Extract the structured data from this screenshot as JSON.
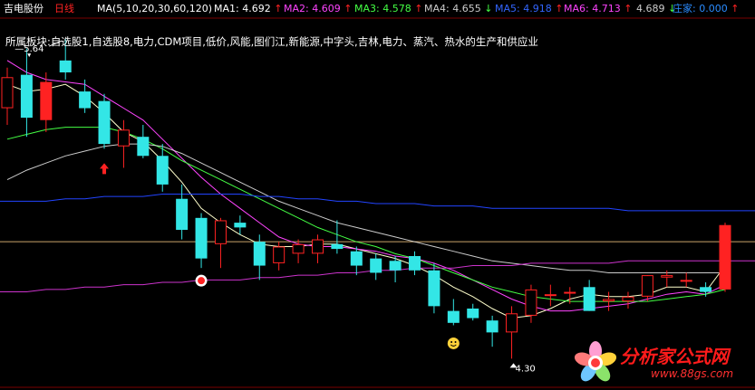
{
  "header": {
    "stock_name": "吉电股份",
    "period": "日线",
    "ma_spec": "MA(5,10,20,30,60,120)",
    "indicators": [
      {
        "label": "MA1:",
        "value": "4.692",
        "trend": "↑",
        "color": "#ffffff"
      },
      {
        "label": "MA2:",
        "value": "4.609",
        "trend": "↑",
        "color": "#ff44ff"
      },
      {
        "label": "MA3:",
        "value": "4.578",
        "trend": "↑",
        "color": "#44ff44"
      },
      {
        "label": "MA4:",
        "value": "4.655",
        "trend": "↓",
        "color": "#cccccc"
      },
      {
        "label": "MA5:",
        "value": "4.918",
        "trend": "↑",
        "color": "#3366ff"
      },
      {
        "label": "MA6:",
        "value": "4.713",
        "trend": "↑",
        "color": "#ff44ff"
      },
      {
        "label": "",
        "value": "4.689",
        "trend": "↓",
        "color": "#cccccc"
      },
      {
        "label": "庄家:",
        "value": "0.000",
        "trend": "↑",
        "color": "#2a8cff"
      }
    ]
  },
  "blocks_text": "所属板块:自选股1,自选股8,电力,CDM项目,低价,风能,图们江,新能源,中字头,吉林,电力、蒸汽、热水的生产和供应业",
  "watermark": {
    "text": "分析家公式网",
    "url": "www.88gs.com"
  },
  "chart_data": {
    "type": "candlestick",
    "price_range": [
      4.18,
      5.72
    ],
    "high_annotation": "5.64",
    "low_annotation": "4.30",
    "colors": {
      "up": "#ff2222",
      "down": "#33e6e6",
      "ma5": "#ffffcc",
      "ma10": "#ff44ff",
      "ma20": "#44ff44",
      "ma60": "#2244ff",
      "ma120": "#cc33cc",
      "level": "#c9a36a"
    },
    "candles": [
      {
        "o": 5.35,
        "h": 5.52,
        "l": 5.28,
        "c": 5.48
      },
      {
        "o": 5.49,
        "h": 5.6,
        "l": 5.23,
        "c": 5.31
      },
      {
        "o": 5.3,
        "h": 5.5,
        "l": 5.25,
        "c": 5.46
      },
      {
        "o": 5.55,
        "h": 5.64,
        "l": 5.47,
        "c": 5.5
      },
      {
        "o": 5.42,
        "h": 5.47,
        "l": 5.33,
        "c": 5.35
      },
      {
        "o": 5.38,
        "h": 5.41,
        "l": 5.18,
        "c": 5.2
      },
      {
        "o": 5.19,
        "h": 5.3,
        "l": 5.1,
        "c": 5.26
      },
      {
        "o": 5.23,
        "h": 5.28,
        "l": 5.14,
        "c": 5.15
      },
      {
        "o": 5.15,
        "h": 5.2,
        "l": 5.0,
        "c": 5.03
      },
      {
        "o": 4.97,
        "h": 5.03,
        "l": 4.8,
        "c": 4.84
      },
      {
        "o": 4.89,
        "h": 4.91,
        "l": 4.68,
        "c": 4.72
      },
      {
        "o": 4.78,
        "h": 4.89,
        "l": 4.68,
        "c": 4.88
      },
      {
        "o": 4.87,
        "h": 4.9,
        "l": 4.82,
        "c": 4.85
      },
      {
        "o": 4.79,
        "h": 4.82,
        "l": 4.63,
        "c": 4.69
      },
      {
        "o": 4.7,
        "h": 4.79,
        "l": 4.67,
        "c": 4.77
      },
      {
        "o": 4.74,
        "h": 4.8,
        "l": 4.7,
        "c": 4.78
      },
      {
        "o": 4.74,
        "h": 4.82,
        "l": 4.7,
        "c": 4.8
      },
      {
        "o": 4.78,
        "h": 4.88,
        "l": 4.74,
        "c": 4.76
      },
      {
        "o": 4.75,
        "h": 4.77,
        "l": 4.65,
        "c": 4.69
      },
      {
        "o": 4.72,
        "h": 4.74,
        "l": 4.63,
        "c": 4.66
      },
      {
        "o": 4.71,
        "h": 4.73,
        "l": 4.62,
        "c": 4.67
      },
      {
        "o": 4.73,
        "h": 4.75,
        "l": 4.65,
        "c": 4.67
      },
      {
        "o": 4.67,
        "h": 4.7,
        "l": 4.49,
        "c": 4.52
      },
      {
        "o": 4.5,
        "h": 4.55,
        "l": 4.44,
        "c": 4.45
      },
      {
        "o": 4.51,
        "h": 4.53,
        "l": 4.46,
        "c": 4.47
      },
      {
        "o": 4.46,
        "h": 4.48,
        "l": 4.35,
        "c": 4.41
      },
      {
        "o": 4.41,
        "h": 4.52,
        "l": 4.3,
        "c": 4.49
      },
      {
        "o": 4.48,
        "h": 4.61,
        "l": 4.45,
        "c": 4.59
      },
      {
        "o": 4.57,
        "h": 4.61,
        "l": 4.52,
        "c": 4.57
      },
      {
        "o": 4.58,
        "h": 4.6,
        "l": 4.53,
        "c": 4.58
      },
      {
        "o": 4.6,
        "h": 4.63,
        "l": 4.5,
        "c": 4.5
      },
      {
        "o": 4.54,
        "h": 4.58,
        "l": 4.5,
        "c": 4.55
      },
      {
        "o": 4.54,
        "h": 4.58,
        "l": 4.51,
        "c": 4.56
      },
      {
        "o": 4.56,
        "h": 4.65,
        "l": 4.54,
        "c": 4.65
      },
      {
        "o": 4.64,
        "h": 4.67,
        "l": 4.6,
        "c": 4.65
      },
      {
        "o": 4.63,
        "h": 4.66,
        "l": 4.6,
        "c": 4.63
      },
      {
        "o": 4.6,
        "h": 4.62,
        "l": 4.56,
        "c": 4.58
      },
      {
        "o": 4.59,
        "h": 4.87,
        "l": 4.58,
        "c": 4.86
      }
    ],
    "ma_lines": {
      "ma5": [
        5.45,
        5.42,
        5.43,
        5.45,
        5.4,
        5.33,
        5.25,
        5.21,
        5.13,
        5.04,
        4.93,
        4.87,
        4.82,
        4.78,
        4.77,
        4.77,
        4.78,
        4.78,
        4.76,
        4.74,
        4.72,
        4.69,
        4.65,
        4.6,
        4.56,
        4.51,
        4.47,
        4.48,
        4.51,
        4.55,
        4.57,
        4.56,
        4.56,
        4.57,
        4.6,
        4.6,
        4.58,
        4.69
      ],
      "ma10": [
        5.55,
        5.5,
        5.47,
        5.46,
        5.45,
        5.4,
        5.35,
        5.3,
        5.22,
        5.14,
        5.06,
        4.99,
        4.93,
        4.87,
        4.81,
        4.78,
        4.77,
        4.77,
        4.76,
        4.75,
        4.73,
        4.72,
        4.7,
        4.67,
        4.63,
        4.59,
        4.55,
        4.52,
        4.5,
        4.5,
        4.51,
        4.52,
        4.53,
        4.55,
        4.57,
        4.58,
        4.57,
        4.61
      ],
      "ma20": [
        5.22,
        5.24,
        5.26,
        5.27,
        5.27,
        5.27,
        5.25,
        5.22,
        5.18,
        5.13,
        5.09,
        5.05,
        5.01,
        4.97,
        4.93,
        4.89,
        4.85,
        4.82,
        4.79,
        4.77,
        4.74,
        4.72,
        4.69,
        4.66,
        4.63,
        4.6,
        4.58,
        4.56,
        4.55,
        4.54,
        4.54,
        4.54,
        4.54,
        4.54,
        4.55,
        4.56,
        4.57,
        4.59
      ],
      "ma30": [
        5.05,
        5.09,
        5.12,
        5.15,
        5.17,
        5.19,
        5.2,
        5.2,
        5.19,
        5.16,
        5.12,
        5.08,
        5.04,
        5.0,
        4.96,
        4.93,
        4.9,
        4.87,
        4.85,
        4.83,
        4.81,
        4.79,
        4.77,
        4.75,
        4.73,
        4.71,
        4.7,
        4.69,
        4.68,
        4.67,
        4.67,
        4.66,
        4.66,
        4.66,
        4.66,
        4.66,
        4.66,
        4.66
      ],
      "ma60": [
        4.96,
        4.96,
        4.96,
        4.97,
        4.97,
        4.98,
        4.98,
        4.98,
        4.99,
        4.99,
        4.99,
        4.99,
        4.99,
        4.98,
        4.98,
        4.97,
        4.97,
        4.96,
        4.96,
        4.95,
        4.95,
        4.95,
        4.94,
        4.94,
        4.94,
        4.93,
        4.93,
        4.93,
        4.93,
        4.93,
        4.93,
        4.93,
        4.92,
        4.92,
        4.92,
        4.92,
        4.92,
        4.92
      ],
      "ma120": [
        4.58,
        4.58,
        4.59,
        4.59,
        4.6,
        4.6,
        4.61,
        4.61,
        4.62,
        4.62,
        4.63,
        4.63,
        4.63,
        4.64,
        4.64,
        4.65,
        4.65,
        4.66,
        4.66,
        4.67,
        4.67,
        4.68,
        4.68,
        4.68,
        4.69,
        4.69,
        4.69,
        4.7,
        4.7,
        4.7,
        4.7,
        4.7,
        4.71,
        4.71,
        4.71,
        4.71,
        4.71,
        4.71
      ]
    },
    "level_line": 4.79,
    "markers": [
      {
        "type": "up-arrow",
        "index": 5
      },
      {
        "type": "buy-circle",
        "index": 10
      },
      {
        "type": "smiley",
        "index": 23
      }
    ]
  }
}
